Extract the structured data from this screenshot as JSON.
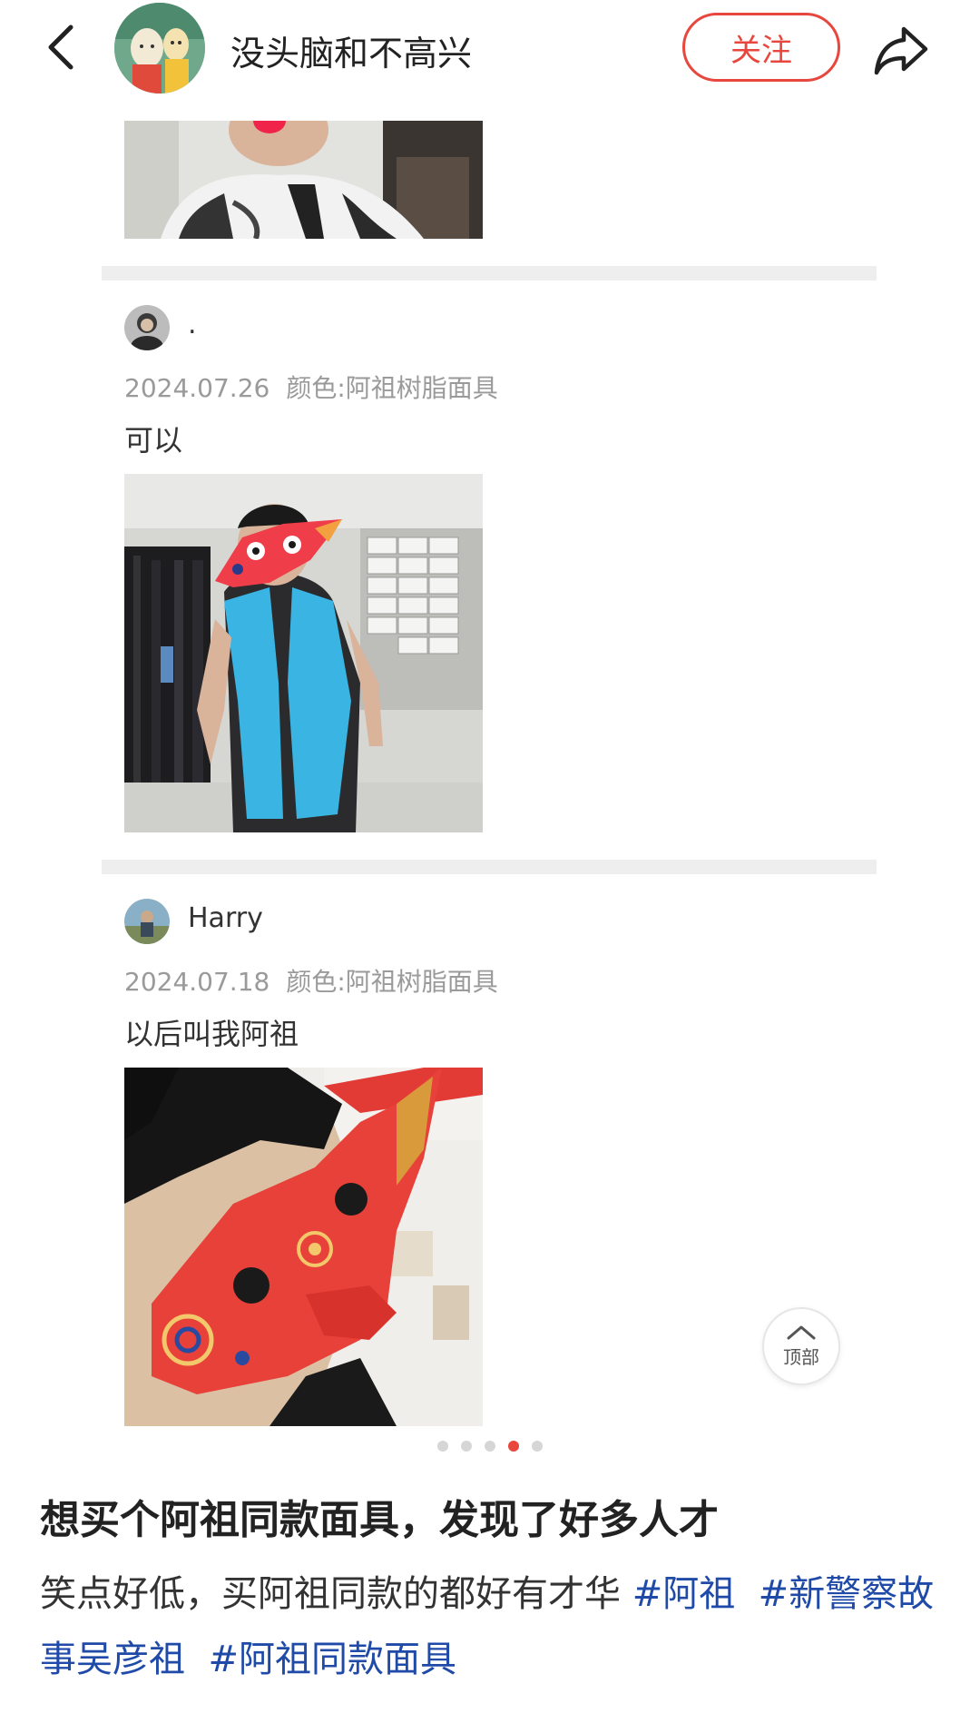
{
  "header": {
    "author_name": "没头脑和不高兴",
    "follow_label": "关注",
    "back_icon": "chevron-left-icon",
    "share_icon": "share-icon"
  },
  "reviews": [
    {
      "name": ".",
      "date": "2024.07.26",
      "spec": "颜色:阿祖树脂面具",
      "text": "可以"
    },
    {
      "name": "Harry",
      "date": "2024.07.18",
      "spec": "颜色:阿祖树脂面具",
      "text": "以后叫我阿祖"
    }
  ],
  "top_button": {
    "label": "顶部",
    "icon": "chevron-up-icon"
  },
  "carousel": {
    "count": 5,
    "active_index": 3
  },
  "post": {
    "title": "想买个阿祖同款面具，发现了好多人才",
    "body_text": "笑点好低，买阿祖同款的都好有才华",
    "tags": [
      "#阿祖",
      "#新警察故事吴彦祖",
      "#阿祖同款面具"
    ]
  },
  "colors": {
    "accent": "#e8473e",
    "tag": "#1f4aa8",
    "meta": "#9a9a9a"
  }
}
